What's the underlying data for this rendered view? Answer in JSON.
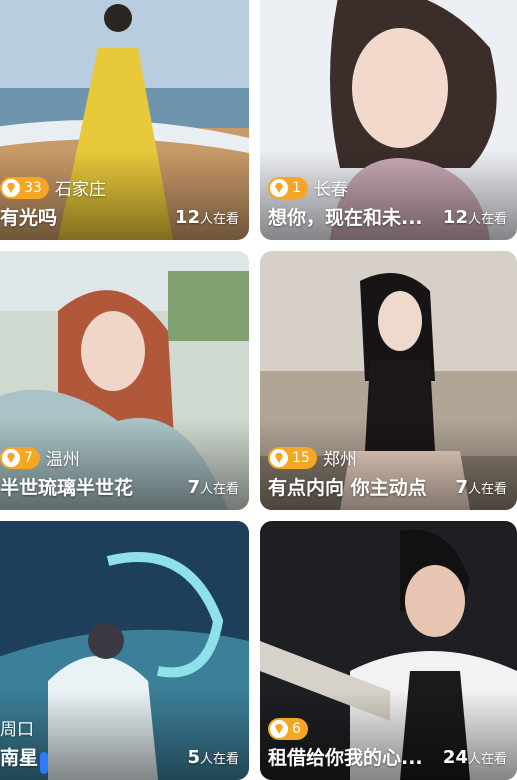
{
  "cards": [
    {
      "level": "33",
      "city": "石家庄",
      "title": "有光吗",
      "viewers": "12",
      "viewers_unit": "人在看"
    },
    {
      "level": "1",
      "city": "长春",
      "title": "想你，现在和未...",
      "viewers": "12",
      "viewers_unit": "人在看"
    },
    {
      "level": "7",
      "city": "温州",
      "title": "半世琉璃半世花",
      "viewers": "7",
      "viewers_unit": "人在看"
    },
    {
      "level": "15",
      "city": "郑州",
      "title": "有点内向 你主动点",
      "viewers": "7",
      "viewers_unit": "人在看"
    },
    {
      "level": "",
      "city": "周口",
      "title": "南星",
      "viewers": "5",
      "viewers_unit": "人在看"
    },
    {
      "level": "6",
      "city": "",
      "title": "租借给你我的心...",
      "viewers": "24",
      "viewers_unit": "人在看"
    }
  ],
  "colors": {
    "badge": "#f5a623",
    "accent_blue": "#2a7bff"
  }
}
